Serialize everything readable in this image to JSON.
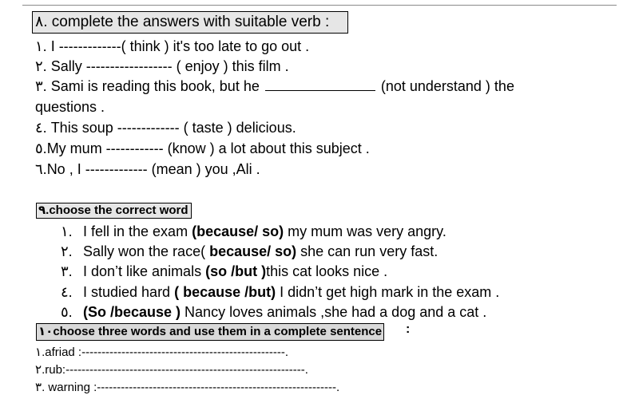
{
  "section8": {
    "heading": "٨. complete the answers with suitable verb :",
    "items": [
      {
        "num": "١. ",
        "text": "I -------------( think ) it's too late to go out ."
      },
      {
        "num": "٢. ",
        "text": "Sally   ------------------ ( enjoy ) this film ."
      },
      {
        "num": "٣. ",
        "pre": "Sami is reading this book, but he ",
        "post": " (not understand ) the"
      },
      {
        "num": "",
        "text": "questions   ."
      },
      {
        "num": "٤. ",
        "text": " This  soup ------------- ( taste ) delicious."
      },
      {
        "num": "٥.",
        "text": "My mum ------------ (know ) a lot  about this subject ."
      },
      {
        "num": "٦.",
        "text": "No , I ------------- (mean ) you ,Ali ."
      }
    ]
  },
  "section9": {
    "num": "٩.",
    "heading": "choose the correct word",
    "items": [
      {
        "num": "١.",
        "pre": "I fell  in the exam  ",
        "bold": "(because/ so)",
        "post": " my mum was very angry."
      },
      {
        "num": "٢.",
        "pre": "Sally won the race(  ",
        "bold": "because/ so)",
        "post": "  she can run very fast."
      },
      {
        "num": "٣.",
        "pre": "I don’t like animals ",
        "bold": "(so /but )",
        "post": "this cat looks nice ."
      },
      {
        "num": "٤.",
        "pre": "I studied hard ",
        "bold": "( because /but)",
        "post": "  I didn’t get high mark in the exam ."
      },
      {
        "num": "٥.",
        "pre": "",
        "bold": "(So /because )",
        "post": " Nancy loves animals ,she had a dog and a cat ."
      }
    ]
  },
  "section10": {
    "num": "١٠",
    "heading": "choose three words and use them in a complete sentence",
    "colon": ":",
    "items": [
      {
        "num": "١",
        "text": ".afriad :---------------------------------------------------."
      },
      {
        "num": "٢",
        "text": ".rub:------------------------------------------------------------."
      },
      {
        "num": "٣",
        "text": ". warning :------------------------------------------------------------."
      }
    ]
  }
}
